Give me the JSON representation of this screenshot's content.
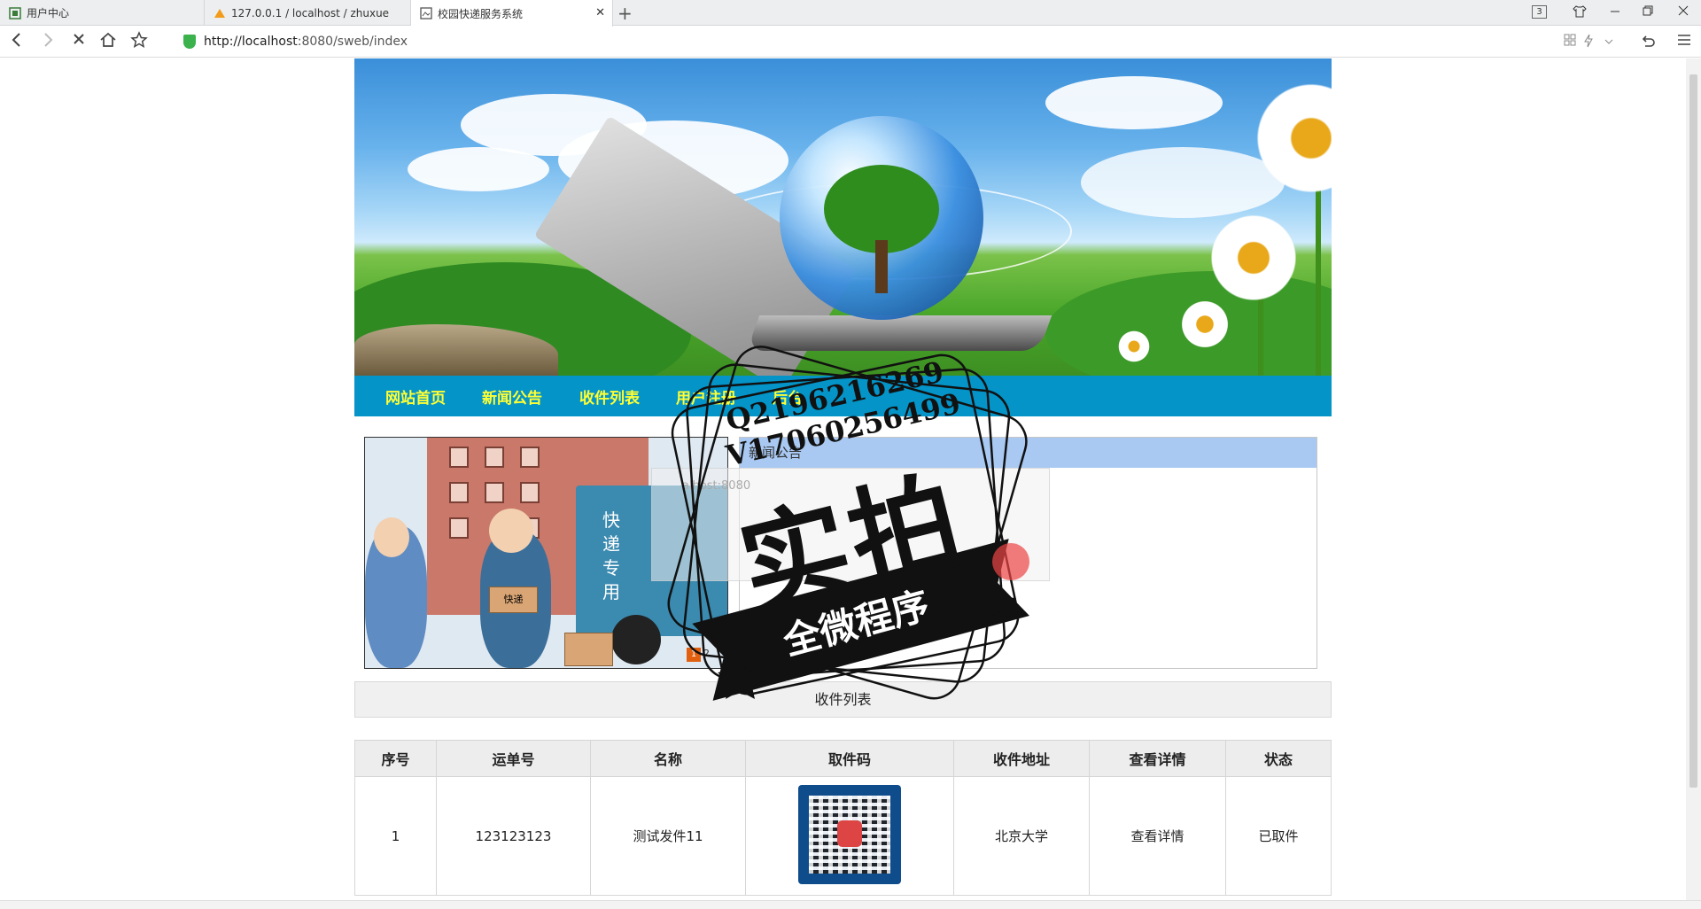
{
  "browser": {
    "tabs": [
      {
        "label": "用户中心",
        "active": false
      },
      {
        "label": "127.0.0.1 / localhost / zhuxue",
        "active": false
      },
      {
        "label": "校园快递服务系统",
        "active": true
      }
    ],
    "tab_count_badge": "3",
    "url_host": "http://localhost",
    "url_path": ":8080/sweb/index"
  },
  "menu": {
    "items": [
      "网站首页",
      "新闻公告",
      "收件列表",
      "用户注册",
      "后台"
    ]
  },
  "slideshow": {
    "truck_text": "快递专用",
    "box_text": "快递",
    "current_slide": "1",
    "next_slide": "2"
  },
  "notice": {
    "title": "新闻公告"
  },
  "section": {
    "title": "收件列表"
  },
  "table": {
    "headers": [
      "序号",
      "运单号",
      "名称",
      "取件码",
      "收件地址",
      "查看详情",
      "状态"
    ],
    "rows": [
      {
        "no": "1",
        "waybill": "123123123",
        "name": "测试发件11",
        "pickup_code": "qr-code",
        "address": "北京大学",
        "detail": "查看详情",
        "status": "已取件"
      }
    ]
  },
  "watermark": {
    "line1": "Q2196216269",
    "line2": "V17060256499",
    "big": "实拍",
    "ribbon": "全微程序",
    "ghost_url": "alhost:8080"
  }
}
